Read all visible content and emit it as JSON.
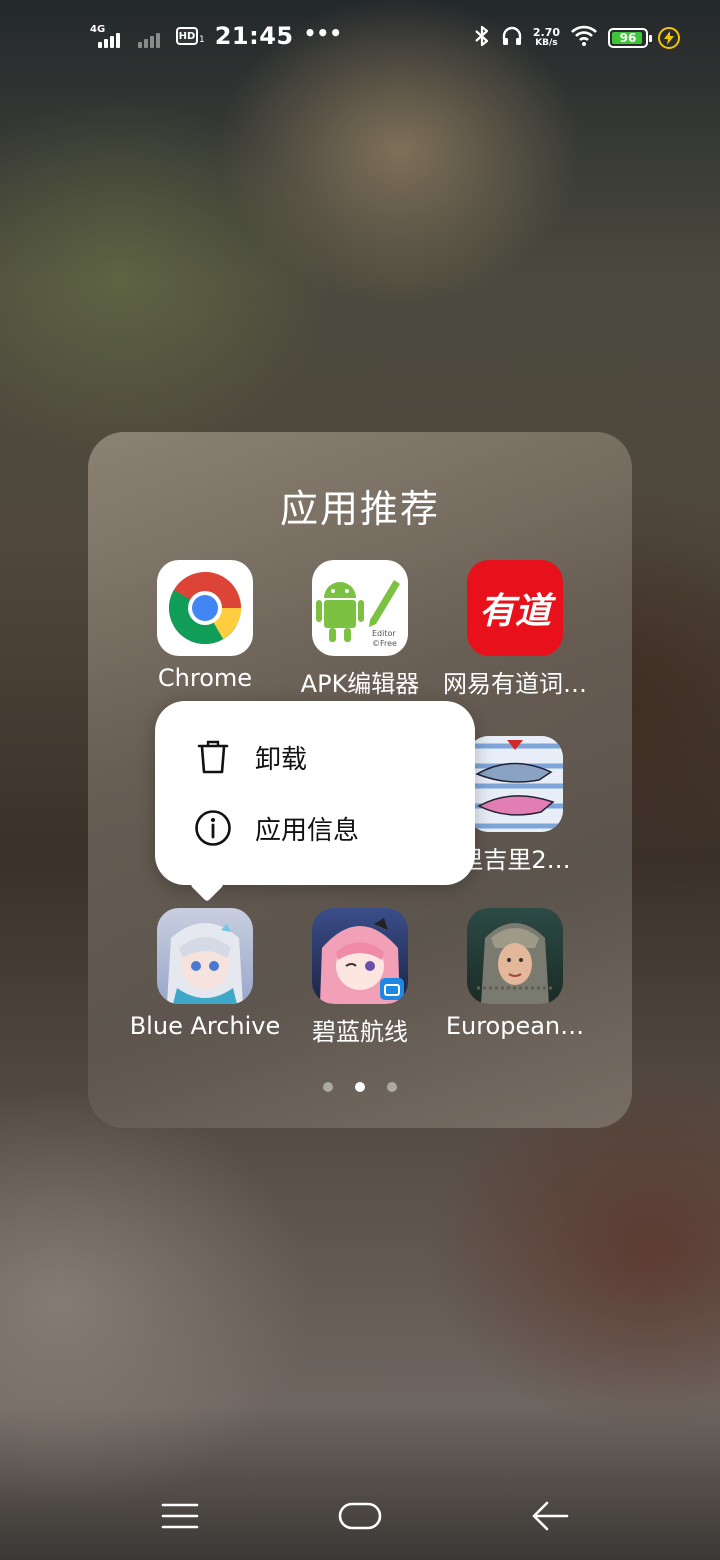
{
  "status_bar": {
    "network_type": "4G",
    "hd_label": "HD",
    "hd_sub": "1",
    "time": "21:45",
    "more_dots": "•••",
    "speed_value": "2.70",
    "speed_unit": "KB/s",
    "battery_level": "96"
  },
  "folder": {
    "title": "应用推荐",
    "apps": [
      {
        "label": "Chrome",
        "icon": "chrome-icon"
      },
      {
        "label": "APK编辑器",
        "icon": "apk-editor-icon"
      },
      {
        "label": "网易有道词…",
        "icon": "youdao-icon",
        "icon_text": "有道"
      },
      {
        "label": "哔哩吉里2…",
        "icon": "shark-game-icon"
      },
      {
        "label": "Blue Archive",
        "icon": "blue-archive-icon"
      },
      {
        "label": "碧蓝航线",
        "icon": "azur-lane-icon"
      },
      {
        "label": "European…",
        "icon": "european-war-icon"
      }
    ],
    "visible_partial_label": "里吉里2…",
    "pages": 3,
    "current_page": 2
  },
  "popup_menu": {
    "uninstall": "卸载",
    "app_info": "应用信息"
  },
  "colors": {
    "youdao_red": "#e8101b",
    "battery_green": "#3ec53a",
    "popup_bg": "#ffffff"
  }
}
